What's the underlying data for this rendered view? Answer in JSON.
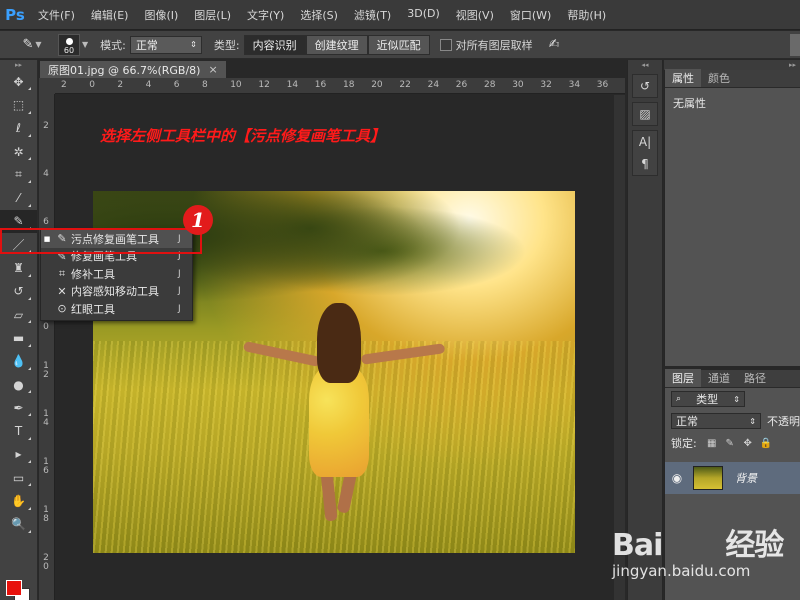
{
  "app": {
    "logo": "Ps",
    "menu": [
      "文件(F)",
      "编辑(E)",
      "图像(I)",
      "图层(L)",
      "文字(Y)",
      "选择(S)",
      "滤镜(T)",
      "3D(D)",
      "视图(V)",
      "窗口(W)",
      "帮助(H)"
    ]
  },
  "options": {
    "brush_size": "60",
    "mode_label": "模式:",
    "mode_value": "正常",
    "type_label": "类型:",
    "type_buttons": [
      "内容识别",
      "创建纹理",
      "近似匹配"
    ],
    "sample_all_label": "对所有图层取样"
  },
  "document": {
    "tab_title": "原图01.jpg @ 66.7%(RGB/8)",
    "tab_close": "×",
    "ruler_h": [
      "2",
      "0",
      "2",
      "4",
      "6",
      "8",
      "10",
      "12",
      "14",
      "16",
      "18",
      "20",
      "22",
      "24",
      "26",
      "28",
      "30",
      "32",
      "34",
      "36"
    ],
    "ruler_v": [
      [
        "2"
      ],
      [
        "4"
      ],
      [
        "6"
      ],
      [
        "8"
      ],
      [
        "1",
        "0"
      ],
      [
        "1",
        "2"
      ],
      [
        "1",
        "4"
      ],
      [
        "1",
        "6"
      ],
      [
        "1",
        "8"
      ],
      [
        "2",
        "0"
      ]
    ]
  },
  "annotation": {
    "instruction": "选择左侧工具栏中的【污点修复画笔工具】",
    "step_badge": "1"
  },
  "flyout": {
    "items": [
      {
        "label": "污点修复画笔工具",
        "key": "J",
        "icon": "spot-healing-icon",
        "glyph": "✎",
        "active": true
      },
      {
        "label": "修复画笔工具",
        "key": "J",
        "icon": "healing-brush-icon",
        "glyph": "✎",
        "active": false
      },
      {
        "label": "修补工具",
        "key": "J",
        "icon": "patch-icon",
        "glyph": "⌗",
        "active": false
      },
      {
        "label": "内容感知移动工具",
        "key": "J",
        "icon": "content-aware-move-icon",
        "glyph": "✕",
        "active": false
      },
      {
        "label": "红眼工具",
        "key": "J",
        "icon": "red-eye-icon",
        "glyph": "⊙",
        "active": false
      }
    ]
  },
  "tools": [
    {
      "name": "move-tool",
      "glyph": "✥"
    },
    {
      "name": "marquee-tool",
      "glyph": "⬚"
    },
    {
      "name": "lasso-tool",
      "glyph": "ℓ"
    },
    {
      "name": "magic-wand-tool",
      "glyph": "✲"
    },
    {
      "name": "crop-tool",
      "glyph": "⌗"
    },
    {
      "name": "eyedropper-tool",
      "glyph": "⁄"
    },
    {
      "name": "spot-healing-tool",
      "glyph": "✎",
      "selected": true
    },
    {
      "name": "brush-tool",
      "glyph": "／"
    },
    {
      "name": "clone-stamp-tool",
      "glyph": "♜"
    },
    {
      "name": "history-brush-tool",
      "glyph": "↺"
    },
    {
      "name": "eraser-tool",
      "glyph": "▱"
    },
    {
      "name": "gradient-tool",
      "glyph": "▬"
    },
    {
      "name": "blur-tool",
      "glyph": "💧"
    },
    {
      "name": "dodge-tool",
      "glyph": "●"
    },
    {
      "name": "pen-tool",
      "glyph": "✒"
    },
    {
      "name": "type-tool",
      "glyph": "T"
    },
    {
      "name": "path-selection-tool",
      "glyph": "▸"
    },
    {
      "name": "shape-tool",
      "glyph": "▭"
    },
    {
      "name": "hand-tool",
      "glyph": "✋"
    },
    {
      "name": "zoom-tool",
      "glyph": "🔍"
    }
  ],
  "colors": {
    "foreground": "#e8120c",
    "background": "#ffffff",
    "accent_red": "#e01010"
  },
  "dock": {
    "group1": [
      {
        "name": "history-icon",
        "glyph": "↺"
      }
    ],
    "group2": [
      {
        "name": "brush-presets-icon",
        "glyph": "▨"
      }
    ],
    "group3": [
      {
        "name": "character-icon",
        "glyph": "A|"
      },
      {
        "name": "paragraph-icon",
        "glyph": "¶"
      }
    ]
  },
  "properties_panel": {
    "tabs": [
      "属性",
      "颜色"
    ],
    "body": "无属性"
  },
  "layers_panel": {
    "tabs": [
      "图层",
      "通道",
      "路径"
    ],
    "filter_label": "类型",
    "blend_mode": "正常",
    "opacity_label": "不透明",
    "lock_label": "锁定:",
    "layer_name": "背景"
  },
  "watermark": {
    "logo": "Bai",
    "cn": "经验",
    "url": "jingyan.baidu.com"
  }
}
